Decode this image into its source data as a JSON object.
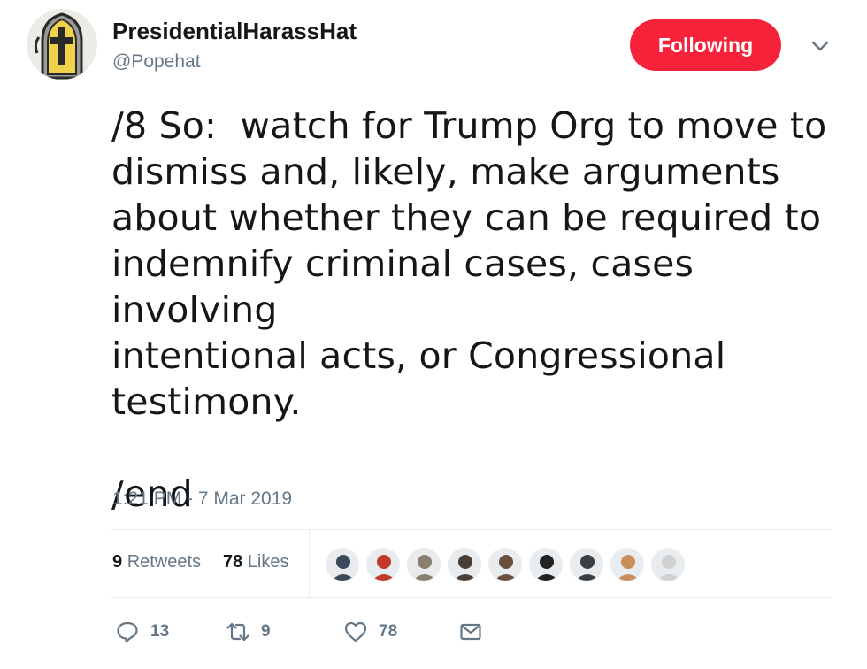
{
  "author": {
    "display_name": "PresidentialHarassHat",
    "handle": "@Popehat",
    "avatar_icon": "mitre-hat-avatar"
  },
  "follow_button": {
    "label": "Following",
    "color": "#f5223a"
  },
  "tweet": {
    "text": "/8 So:  watch for Trump Org to move to\ndismiss and, likely, make arguments\nabout whether they can be required to\nindemnify criminal cases, cases involving\nintentional acts, or Congressional\ntestimony.\n\n/end",
    "timestamp": "1:21 PM - 7 Mar 2019"
  },
  "stats": {
    "retweets_count": "9",
    "retweets_label": "Retweets",
    "likes_count": "78",
    "likes_label": "Likes"
  },
  "likers": [
    {
      "icon": "liker-avatar-1",
      "color": "#3b4a5a"
    },
    {
      "icon": "liker-avatar-2",
      "color": "#c0392b"
    },
    {
      "icon": "liker-avatar-3",
      "color": "#8a7f70"
    },
    {
      "icon": "liker-avatar-4",
      "color": "#4a4038"
    },
    {
      "icon": "liker-avatar-5",
      "color": "#6b4e3d"
    },
    {
      "icon": "liker-avatar-6",
      "color": "#222222"
    },
    {
      "icon": "liker-avatar-7",
      "color": "#3a3f44"
    },
    {
      "icon": "liker-avatar-8",
      "color": "#c98e5b"
    },
    {
      "icon": "liker-avatar-9",
      "color": "#d0d0d0"
    }
  ],
  "actions": {
    "reply_count": "13",
    "retweet_count": "9",
    "like_count": "78",
    "reply_icon": "reply-icon",
    "retweet_icon": "retweet-icon",
    "like_icon": "heart-icon",
    "dm_icon": "envelope-icon"
  },
  "colors": {
    "text_secondary": "#657786",
    "divider": "#e6ecf0"
  }
}
